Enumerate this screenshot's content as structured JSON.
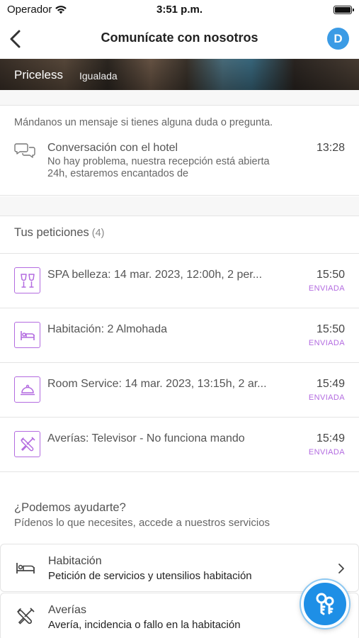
{
  "status_bar": {
    "carrier": "Operador",
    "time": "3:51 p.m."
  },
  "nav": {
    "title": "Comunícate con nosotros",
    "avatar_initial": "D"
  },
  "hotel": {
    "brand": "Priceless",
    "location": "Igualada"
  },
  "message": {
    "intro": "Mándanos un mensaje si tienes alguna duda o pregunta.",
    "conversation_title": "Conversación con el hotel",
    "conversation_time": "13:28",
    "conversation_preview": "No hay problema, nuestra recepción está abierta 24h, estaremos encantados de"
  },
  "requests": {
    "title": "Tus peticiones",
    "count": "(4)",
    "items": [
      {
        "icon": "glasses-icon",
        "title": "SPA belleza: 14 mar. 2023, 12:00h, 2 per...",
        "time": "15:50",
        "status": "ENVIADA"
      },
      {
        "icon": "bed-icon",
        "title": "Habitación: 2 Almohada",
        "time": "15:50",
        "status": "ENVIADA"
      },
      {
        "icon": "cloche-icon",
        "title": "Room Service: 14 mar. 2023, 13:15h, 2 ar...",
        "time": "15:49",
        "status": "ENVIADA"
      },
      {
        "icon": "tools-icon",
        "title": "Averías: Televisor - No funciona mando",
        "time": "15:49",
        "status": "ENVIADA"
      }
    ]
  },
  "help": {
    "title": "¿Podemos ayudarte?",
    "subtitle": "Pídenos lo que necesites, accede a nuestros servicios"
  },
  "services": [
    {
      "icon": "bed-icon",
      "title": "Habitación",
      "description": "Petición de servicios y utensilios habitación"
    },
    {
      "icon": "tools-icon",
      "title": "Averías",
      "description": "Avería, incidencia o fallo en la habitación"
    }
  ],
  "colors": {
    "accent_purple": "#b36be0",
    "avatar_blue": "#3b9be5",
    "fab_blue": "#1e8fe6"
  }
}
